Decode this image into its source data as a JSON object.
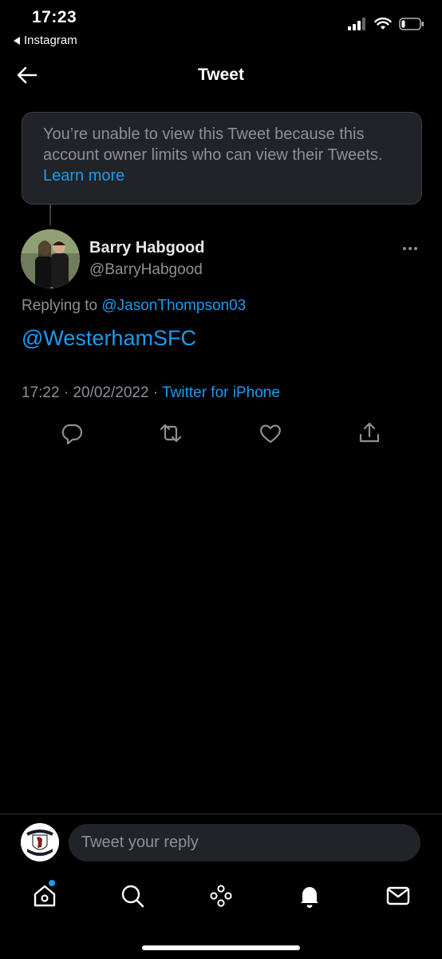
{
  "status_bar": {
    "time": "17:23",
    "back_app": "Instagram",
    "icons": [
      "cellular-signal-icon",
      "wifi-icon",
      "battery-icon"
    ]
  },
  "header": {
    "title": "Tweet",
    "back_icon": "arrow-left-icon"
  },
  "notice": {
    "text": "You’re unable to view this Tweet because this account owner limits who can view their Tweets.",
    "link": "Learn more"
  },
  "tweet": {
    "author_name": "Barry Habgood",
    "author_handle": "@BarryHabgood",
    "replying_prefix": "Replying to",
    "replying_to": "@JasonThompson03",
    "text": "@WesterhamSFC",
    "time": "17:22",
    "date": "20/02/2022",
    "separator": "·",
    "source": "Twitter for iPhone",
    "actions": [
      "reply-icon",
      "retweet-icon",
      "like-icon",
      "share-icon"
    ]
  },
  "reply_bar": {
    "placeholder": "Tweet your reply"
  },
  "tab_bar": {
    "items": [
      "home-icon",
      "search-icon",
      "spaces-icon",
      "notifications-icon",
      "messages-icon"
    ],
    "badge_color": "#1d9bf0"
  },
  "colors": {
    "background": "#000000",
    "accent": "#1d9bf0",
    "secondary_text": "#8b9196"
  }
}
